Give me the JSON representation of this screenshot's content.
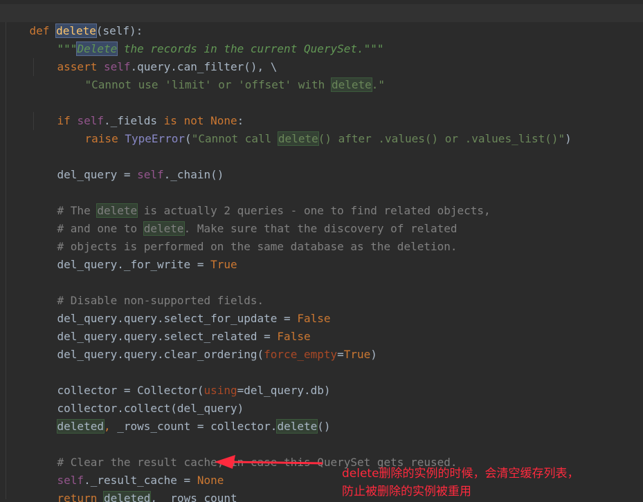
{
  "code": {
    "def_kw": "def",
    "func_name": "delete",
    "params": "(self):",
    "docstring_q1": "\"\"\"",
    "docstring_word": "Delete",
    "docstring_rest": " the records in the current QuerySet.",
    "docstring_q2": "\"\"\"",
    "l3_kw": "assert",
    "l3_self": "self",
    "l3_rest": ".query.can_filter(), \\",
    "l4_str1": "\"Cannot use 'limit' or 'offset' with ",
    "l4_word": "delete",
    "l4_str2": ".\"",
    "l6_if": "if",
    "l6_self": "self",
    "l6_mid": "._fields ",
    "l6_is": "is",
    "l6_not": "not",
    "l6_none": "None",
    "l6_colon": ":",
    "l7_raise": "raise",
    "l7_type": "TypeError",
    "l7_paren": "(",
    "l7_str1": "\"Cannot call ",
    "l7_word": "delete",
    "l7_str2": "() after .values() or .values_list()\"",
    "l7_close": ")",
    "l9_a": "del_query = ",
    "l9_self": "self",
    "l9_b": "._chain()",
    "c1_a": "# The ",
    "c1_word": "delete",
    "c1_b": " is actually 2 queries - one to find related objects,",
    "c2_a": "# and one to ",
    "c2_word": "delete",
    "c2_b": ". Make sure that the discovery of related",
    "c3": "# objects is performed on the same database as the deletion.",
    "l14_a": "del_query._for_write = ",
    "l14_true": "True",
    "c4": "# Disable non-supported fields.",
    "l17_a": "del_query.query.select_for_update = ",
    "l17_v": "False",
    "l18_a": "del_query.query.select_related = ",
    "l18_v": "False",
    "l19_a": "del_query.query.clear_ordering(",
    "l19_param": "force_empty",
    "l19_eq": "=",
    "l19_true": "True",
    "l19_close": ")",
    "l21_a": "collector = Collector(",
    "l21_param": "using",
    "l21_b": "=del_query.db)",
    "l22": "collector.collect(del_query)",
    "l23_word": "deleted",
    "l23_comma": ",",
    "l23_a": " _rows_count = collector.",
    "l23_word2": "delete",
    "l23_b": "()",
    "c5": "# Clear the result cache, in case this QuerySet gets reused.",
    "l26_self": "self",
    "l26_a": "._result_cache = ",
    "l26_none": "None",
    "l27_ret": "return",
    "l27_sp": " ",
    "l27_word": "deleted",
    "l27_b": ", _rows_count"
  },
  "annotation": {
    "line1": "delete删除的实例的时候，会清空缓存列表，",
    "line2": "防止被删除的实例被重用",
    "color": "#ff2a3e"
  }
}
